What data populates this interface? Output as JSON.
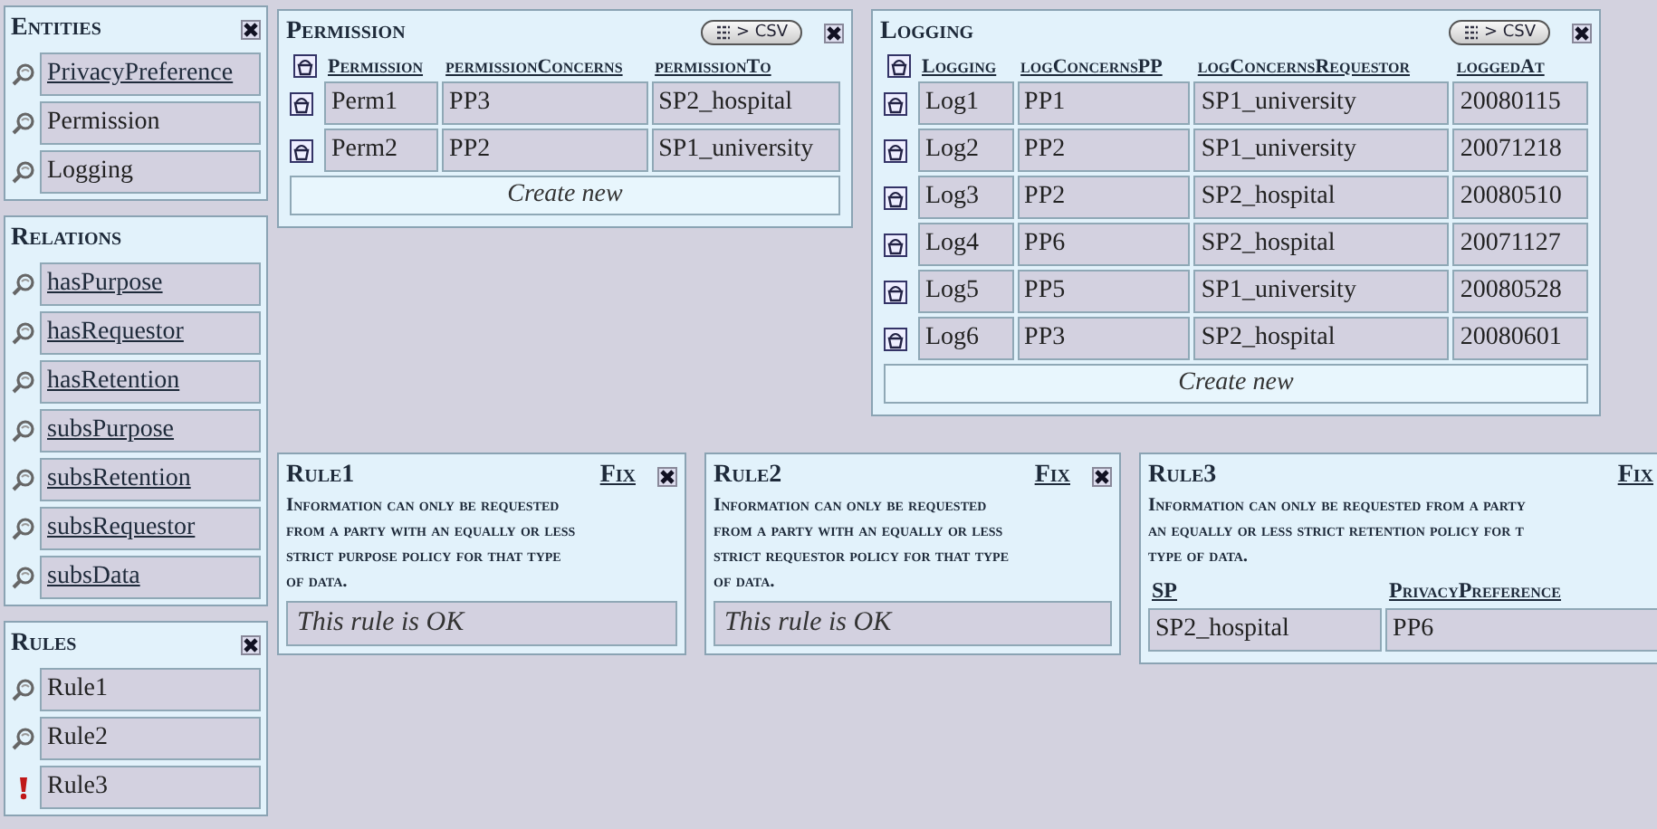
{
  "sidebar": [
    {
      "title": "Entities",
      "closable": true,
      "items": [
        {
          "label": "PrivacyPreference",
          "link": true,
          "kind": "entity"
        },
        {
          "label": "Permission",
          "link": false,
          "kind": "entity"
        },
        {
          "label": "Logging",
          "link": false,
          "kind": "entity"
        }
      ]
    },
    {
      "title": "Relations",
      "closable": false,
      "items": [
        {
          "label": "hasPurpose",
          "link": true,
          "kind": "entity"
        },
        {
          "label": "hasRequestor",
          "link": true,
          "kind": "entity"
        },
        {
          "label": "hasRetention",
          "link": true,
          "kind": "entity"
        },
        {
          "label": "subsPurpose",
          "link": true,
          "kind": "entity"
        },
        {
          "label": "subsRetention",
          "link": true,
          "kind": "entity"
        },
        {
          "label": "subsRequestor",
          "link": true,
          "kind": "entity"
        },
        {
          "label": "subsData",
          "link": true,
          "kind": "entity"
        }
      ]
    },
    {
      "title": "Rules",
      "closable": true,
      "items": [
        {
          "label": "Rule1",
          "link": false,
          "kind": "entity"
        },
        {
          "label": "Rule2",
          "link": false,
          "kind": "entity"
        },
        {
          "label": "Rule3",
          "link": false,
          "kind": "violated"
        }
      ]
    }
  ],
  "tables": [
    {
      "title": "Permission",
      "export": "> CSV",
      "columns": [
        "Permission",
        "permissionConcerns",
        "permissionTo"
      ],
      "rows": [
        [
          "Perm1",
          "PP3",
          "SP2_hospital"
        ],
        [
          "Perm2",
          "PP2",
          "SP1_university"
        ]
      ],
      "create": "Create new"
    },
    {
      "title": "Logging",
      "export": "> CSV",
      "columns": [
        "Logging",
        "logConcernsPP",
        "logConcernsRequestor",
        "loggedAt"
      ],
      "rows": [
        [
          "Log1",
          "PP1",
          "SP1_university",
          "20080115"
        ],
        [
          "Log2",
          "PP2",
          "SP1_university",
          "20071218"
        ],
        [
          "Log3",
          "PP2",
          "SP2_hospital",
          "20080510"
        ],
        [
          "Log4",
          "PP6",
          "SP2_hospital",
          "20071127"
        ],
        [
          "Log5",
          "PP5",
          "SP1_university",
          "20080528"
        ],
        [
          "Log6",
          "PP3",
          "SP2_hospital",
          "20080601"
        ]
      ],
      "create": "Create new"
    }
  ],
  "rules": [
    {
      "title": "Rule1",
      "fix": "Fix",
      "closable": true,
      "kind": "ok",
      "lines": [
        "Information can only be requested",
        "from a party with an equally or less",
        "strict purpose policy for that type",
        "of data."
      ],
      "result": "This rule is OK"
    },
    {
      "title": "Rule2",
      "fix": "Fix",
      "closable": true,
      "kind": "ok",
      "lines": [
        "Information can only be requested",
        "from a party with an equally or less",
        "strict requestor policy for that type",
        "of data."
      ],
      "result": "This rule is OK"
    },
    {
      "title": "Rule3",
      "fix": "Fix",
      "closable": false,
      "kind": "violations",
      "lines": [
        "Information can only be requested from a party",
        "an equally or less strict retention policy for t",
        "type of data."
      ],
      "columns": [
        "SP",
        "PrivacyPreference"
      ],
      "rows": [
        [
          "SP2_hospital",
          "PP6"
        ]
      ]
    }
  ]
}
